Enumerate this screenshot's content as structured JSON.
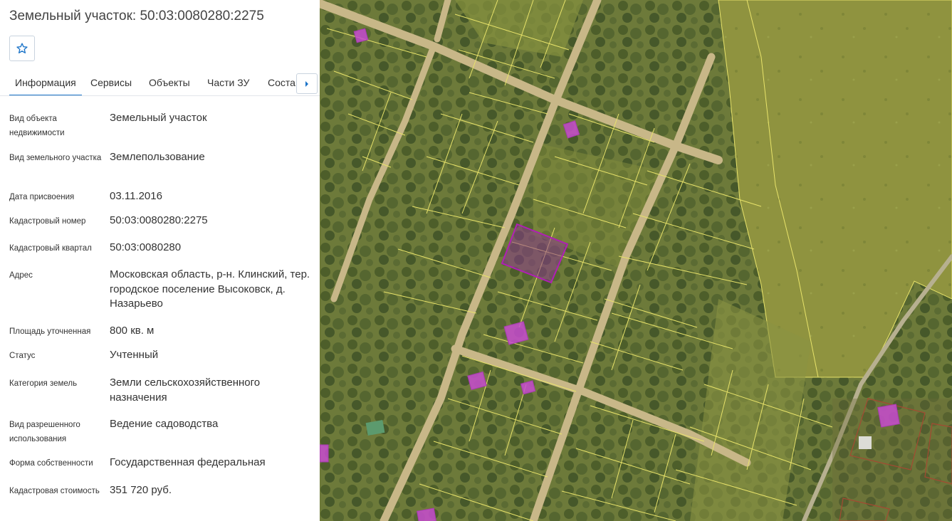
{
  "panel": {
    "title": "Земельный участок: 50:03:0080280:2275",
    "tabs": [
      {
        "label": "Информация",
        "active": true
      },
      {
        "label": "Сервисы",
        "active": false
      },
      {
        "label": "Объекты",
        "active": false
      },
      {
        "label": "Части ЗУ",
        "active": false
      },
      {
        "label": "Состав",
        "active": false
      }
    ],
    "fields": [
      {
        "label": "Вид объекта недвижимости",
        "value": "Земельный участок"
      },
      {
        "label": "Вид земельного участка",
        "value": "Землепользование"
      },
      {
        "label": "Дата присвоения",
        "value": "03.11.2016"
      },
      {
        "label": "Кадастровый номер",
        "value": "50:03:0080280:2275"
      },
      {
        "label": "Кадастровый квартал",
        "value": "50:03:0080280"
      },
      {
        "label": "Адрес",
        "value": "Московская область, р-н. Клинский, тер. городское поселение Высоковск, д. Назарьево"
      },
      {
        "label": "Площадь уточненная",
        "value": "800 кв. м"
      },
      {
        "label": "Статус",
        "value": "Учтенный"
      },
      {
        "label": "Категория земель",
        "value": "Земли сельскохозяйственного назначения"
      },
      {
        "label": "Вид разрешенного использования",
        "value": "Ведение садоводства"
      },
      {
        "label": "Форма собственности",
        "value": "Государственная федеральная"
      },
      {
        "label": "Кадастровая стоимость",
        "value": "351 720 руб."
      }
    ]
  },
  "icons": {
    "favorite": "star-outline-icon",
    "tabs_next": "caret-right-icon"
  },
  "colors": {
    "accent": "#1a73c8",
    "parcel_border": "#e8e36a",
    "selected_parcel": "#b01fb5",
    "building": "#c84bd0"
  }
}
